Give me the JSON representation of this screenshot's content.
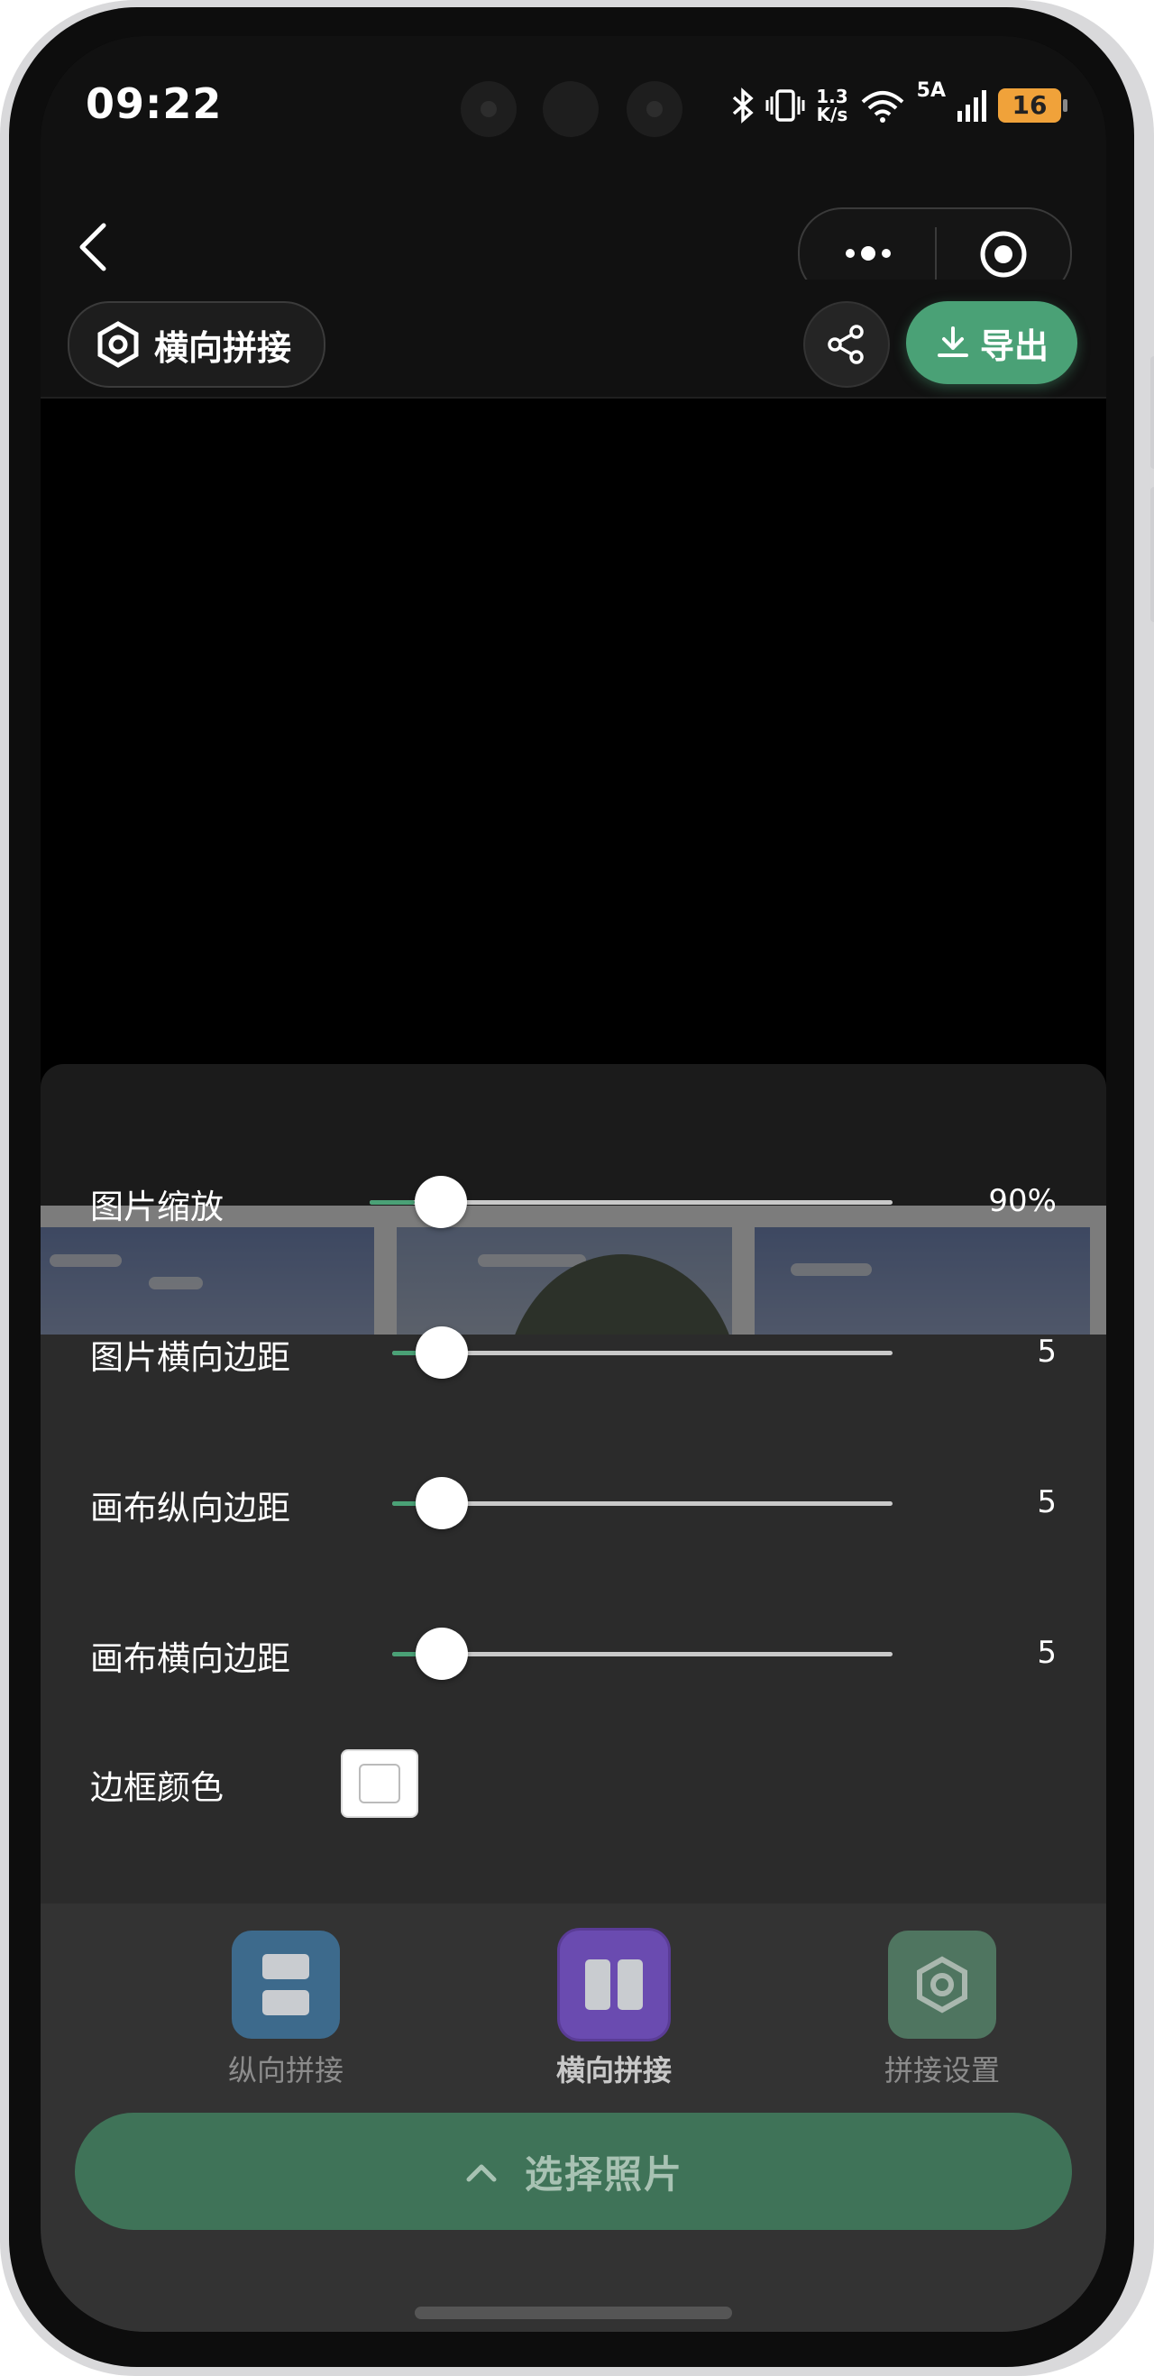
{
  "status_bar": {
    "time": "09:22",
    "net_speed_top": "1.3",
    "net_speed_bottom": "K/s",
    "signal_label": "5A",
    "battery": "16"
  },
  "toolbar": {
    "mode_label": "横向拼接",
    "export_label": "导出"
  },
  "settings": {
    "rows": [
      {
        "label": "图片缩放",
        "value": "90%",
        "level": 0.1
      },
      {
        "label": "图片横向边距",
        "value": "5",
        "level": 0.05
      },
      {
        "label": "画布纵向边距",
        "value": "5",
        "level": 0.05
      },
      {
        "label": "画布横向边距",
        "value": "5",
        "level": 0.05
      }
    ],
    "border_color_label": "边框颜色",
    "border_color": "#ffffff"
  },
  "tabs": [
    {
      "label": "纵向拼接",
      "icon": "vertical-stitch-icon",
      "color": "#3d6a8c",
      "active": false
    },
    {
      "label": "横向拼接",
      "icon": "horizontal-stitch-icon",
      "color": "#6a4bb0",
      "active": true
    },
    {
      "label": "拼接设置",
      "icon": "settings-hexagon-icon",
      "color": "#4f7560",
      "active": false
    }
  ],
  "select_button": {
    "label": "选择照片"
  },
  "colors": {
    "accent_green": "#4aa176",
    "panel_bg": "#2b2b2b"
  }
}
